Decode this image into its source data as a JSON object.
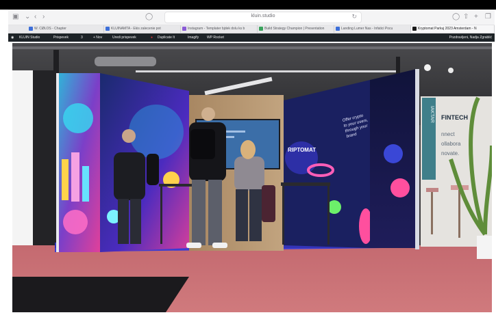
{
  "browser": {
    "url": "kluin.studio",
    "nav_icons": [
      "sidebar-icon",
      "chevron-left-icon",
      "chevron-right-icon",
      "shield-icon",
      "reload-icon",
      "download-icon",
      "share-icon",
      "plus-icon",
      "tabs-icon"
    ],
    "tabs": [
      {
        "label": "W.  CØLOS - Chapter",
        "color": "#3d6fd9"
      },
      {
        "label": "KLUINAMTA - Ekis zalecenie pot",
        "color": "#3d6fd9"
      },
      {
        "label": "Instagram - Templater bjdek dolu ks b",
        "color": "#8a5bd6"
      },
      {
        "label": "Build Strategy Champion | Presentation",
        "color": "#3aa35d"
      },
      {
        "label": "Landing Lumer Nas - Infatici Pocu",
        "color": "#3d6fd9"
      },
      {
        "label": "Kryptomat Parkuj 2023 Amsterdam - N",
        "color": "#1a1a1a"
      }
    ]
  },
  "wp_admin_bar": {
    "items": [
      "KLUIN Studio",
      "Prispevek",
      "3",
      "+ Nov",
      "Uredi prispevek",
      "",
      "Duplicate It",
      "Imagify",
      "WP Rocket"
    ],
    "right_label": "Pozdravljeni, Nadja Zgrablić"
  },
  "photo": {
    "brand_text": "RIPTOMAT",
    "slogan_lines": [
      "Offer crypto",
      "to your users,",
      "through your",
      "brand"
    ],
    "fintech_text": "FINTECH",
    "side_lines": [
      "nnect",
      "ollabora",
      "novate."
    ],
    "banner_letters": "IAKTAR"
  },
  "colors": {
    "booth_floor": "#3c3cd1",
    "carpet": "#c96f73",
    "wood_wall": "#b79873",
    "screen": "#3b6ea8"
  }
}
